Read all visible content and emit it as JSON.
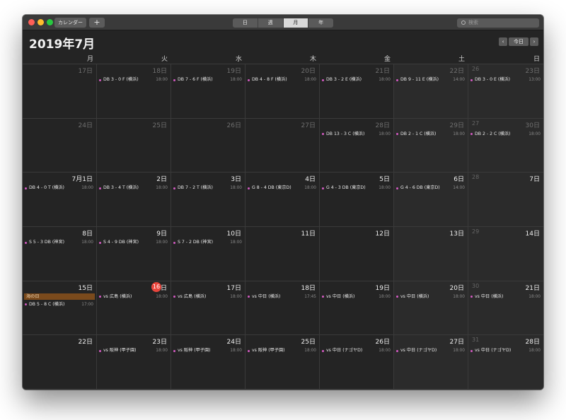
{
  "toolbar": {
    "calendars_label": "カレンダー",
    "add_label": "+",
    "view_tabs": [
      "日",
      "週",
      "月",
      "年"
    ],
    "active_view": "月",
    "search_placeholder": "検索"
  },
  "header": {
    "month_title": "2019年7月",
    "prev_label": "‹",
    "today_label": "今日",
    "next_label": "›"
  },
  "weekdays": [
    "月",
    "火",
    "水",
    "木",
    "金",
    "土",
    "日"
  ],
  "colors": {
    "event_dot": "#d35ac2",
    "today_badge": "#e8453c",
    "holiday_bg": "#7a4a1c"
  },
  "weeks": [
    {
      "weeknum": "26",
      "days": [
        {
          "label": "17日",
          "current": false,
          "events": []
        },
        {
          "label": "18日",
          "current": false,
          "events": [
            {
              "title": "DB 3 - 0 F (横浜)",
              "time": "18:00"
            }
          ]
        },
        {
          "label": "19日",
          "current": false,
          "events": [
            {
              "title": "DB 7 - 6 F (横浜)",
              "time": "18:00"
            }
          ]
        },
        {
          "label": "20日",
          "current": false,
          "events": [
            {
              "title": "DB 4 - 8 F (横浜)",
              "time": "18:00"
            }
          ]
        },
        {
          "label": "21日",
          "current": false,
          "events": [
            {
              "title": "DB 3 - 2 E (横浜)",
              "time": "18:00"
            }
          ]
        },
        {
          "label": "22日",
          "current": false,
          "events": [
            {
              "title": "DB 9 - 11 E (横浜)",
              "time": "14:00"
            }
          ]
        },
        {
          "label": "23日",
          "current": false,
          "events": [
            {
              "title": "DB 3 - 0 E (横浜)",
              "time": "13:00"
            }
          ]
        }
      ]
    },
    {
      "weeknum": "27",
      "days": [
        {
          "label": "24日",
          "current": false,
          "events": []
        },
        {
          "label": "25日",
          "current": false,
          "events": []
        },
        {
          "label": "26日",
          "current": false,
          "events": []
        },
        {
          "label": "27日",
          "current": false,
          "events": []
        },
        {
          "label": "28日",
          "current": false,
          "events": [
            {
              "title": "DB 13 - 3 C (横浜)",
              "time": "18:00"
            }
          ]
        },
        {
          "label": "29日",
          "current": false,
          "events": [
            {
              "title": "DB 2 - 1 C (横浜)",
              "time": "18:00"
            }
          ]
        },
        {
          "label": "30日",
          "current": false,
          "events": [
            {
              "title": "DB 2 - 2 C (横浜)",
              "time": "18:00"
            }
          ]
        }
      ]
    },
    {
      "weeknum": "28",
      "days": [
        {
          "label": "7月1日",
          "current": true,
          "events": [
            {
              "title": "DB 4 - 0 T (横浜)",
              "time": "18:00"
            }
          ]
        },
        {
          "label": "2日",
          "current": true,
          "events": [
            {
              "title": "DB 3 - 4 T (横浜)",
              "time": "18:00"
            }
          ]
        },
        {
          "label": "3日",
          "current": true,
          "events": [
            {
              "title": "DB 7 - 2 T (横浜)",
              "time": "18:00"
            }
          ]
        },
        {
          "label": "4日",
          "current": true,
          "events": [
            {
              "title": "G 8 - 4 DB (東京D)",
              "time": "18:00"
            }
          ]
        },
        {
          "label": "5日",
          "current": true,
          "events": [
            {
              "title": "G 4 - 3 DB (東京D)",
              "time": "18:00"
            }
          ]
        },
        {
          "label": "6日",
          "current": true,
          "events": [
            {
              "title": "G 4 - 6 DB (東京D)",
              "time": "14:00"
            }
          ]
        },
        {
          "label": "7日",
          "current": true,
          "events": []
        }
      ]
    },
    {
      "weeknum": "29",
      "days": [
        {
          "label": "8日",
          "current": true,
          "events": [
            {
              "title": "S 5 - 3 DB (神宮)",
              "time": "18:00"
            }
          ]
        },
        {
          "label": "9日",
          "current": true,
          "events": [
            {
              "title": "S 4 - 9 DB (神宮)",
              "time": "18:00"
            }
          ]
        },
        {
          "label": "10日",
          "current": true,
          "events": [
            {
              "title": "S 7 - 2 DB (神宮)",
              "time": "18:00"
            }
          ]
        },
        {
          "label": "11日",
          "current": true,
          "events": []
        },
        {
          "label": "12日",
          "current": true,
          "events": []
        },
        {
          "label": "13日",
          "current": true,
          "events": []
        },
        {
          "label": "14日",
          "current": true,
          "events": []
        }
      ]
    },
    {
      "weeknum": "30",
      "days": [
        {
          "label": "15日",
          "current": true,
          "holiday": "海の日",
          "events": [
            {
              "title": "DB 5 - 8 C (横浜)",
              "time": "17:00"
            }
          ]
        },
        {
          "label": "16",
          "suffix": "日",
          "today": true,
          "current": true,
          "events": [
            {
              "title": "vs 広島 (横浜)",
              "time": "18:00"
            }
          ]
        },
        {
          "label": "17日",
          "current": true,
          "events": [
            {
              "title": "vs 広島 (横浜)",
              "time": "18:00"
            }
          ]
        },
        {
          "label": "18日",
          "current": true,
          "events": [
            {
              "title": "vs 中日 (横浜)",
              "time": "17:45"
            }
          ]
        },
        {
          "label": "19日",
          "current": true,
          "events": [
            {
              "title": "vs 中日 (横浜)",
              "time": "18:00"
            }
          ]
        },
        {
          "label": "20日",
          "current": true,
          "events": [
            {
              "title": "vs 中日 (横浜)",
              "time": "18:00"
            }
          ]
        },
        {
          "label": "21日",
          "current": true,
          "events": [
            {
              "title": "vs 中日 (横浜)",
              "time": "18:00"
            }
          ]
        }
      ]
    },
    {
      "weeknum": "31",
      "days": [
        {
          "label": "22日",
          "current": true,
          "events": []
        },
        {
          "label": "23日",
          "current": true,
          "events": [
            {
              "title": "vs 阪神 (甲子園)",
              "time": "18:00"
            }
          ]
        },
        {
          "label": "24日",
          "current": true,
          "events": [
            {
              "title": "vs 阪神 (甲子園)",
              "time": "18:00"
            }
          ]
        },
        {
          "label": "25日",
          "current": true,
          "events": [
            {
              "title": "vs 阪神 (甲子園)",
              "time": "18:00"
            }
          ]
        },
        {
          "label": "26日",
          "current": true,
          "events": [
            {
              "title": "vs 中日 (ナゴヤD)",
              "time": "18:00"
            }
          ]
        },
        {
          "label": "27日",
          "current": true,
          "events": [
            {
              "title": "vs 中日 (ナゴヤD)",
              "time": "18:00"
            }
          ]
        },
        {
          "label": "28日",
          "current": true,
          "events": [
            {
              "title": "vs 中日 (ナゴヤD)",
              "time": "18:00"
            }
          ]
        }
      ]
    }
  ]
}
